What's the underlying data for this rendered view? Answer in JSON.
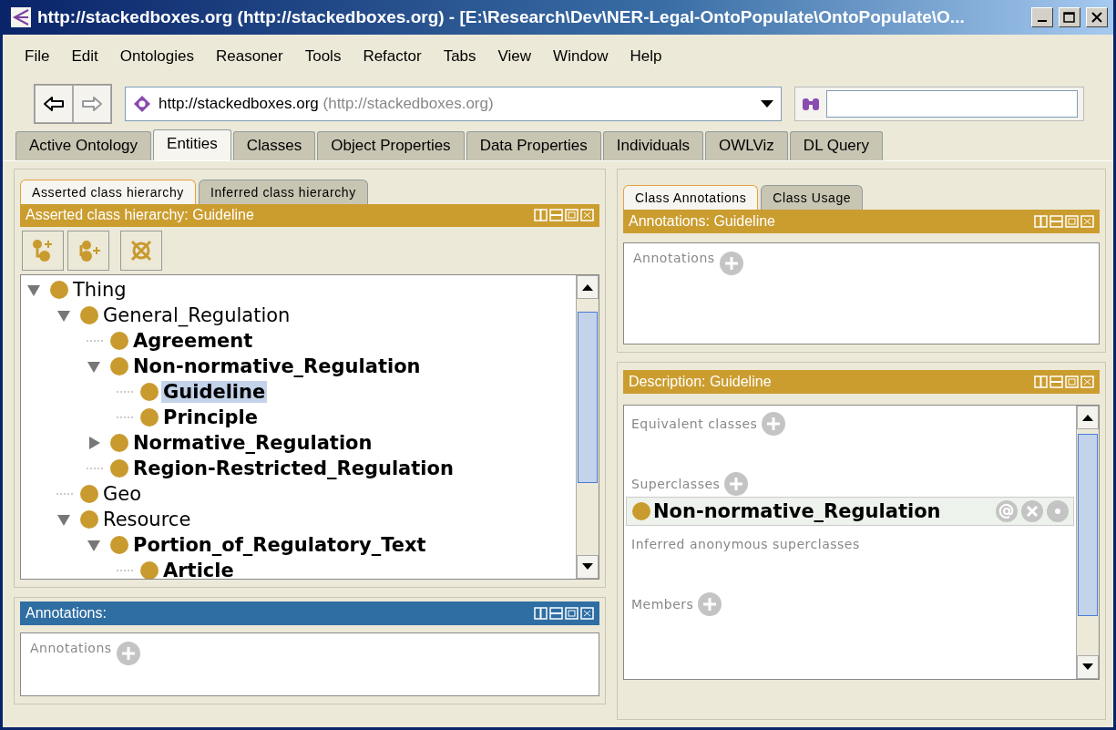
{
  "window": {
    "title": "http://stackedboxes.org (http://stackedboxes.org) - [E:\\Research\\Dev\\NER-Legal-OntoPopulate\\OntoPopulate\\O..."
  },
  "menu": [
    "File",
    "Edit",
    "Ontologies",
    "Reasoner",
    "Tools",
    "Refactor",
    "Tabs",
    "View",
    "Window",
    "Help"
  ],
  "ontology_selector": {
    "iri": "http://stackedboxes.org",
    "detail": "(http://stackedboxes.org)"
  },
  "tabs": [
    {
      "label": "Active Ontology",
      "selected": false
    },
    {
      "label": "Entities",
      "selected": true
    },
    {
      "label": "Classes",
      "selected": false
    },
    {
      "label": "Object Properties",
      "selected": false
    },
    {
      "label": "Data Properties",
      "selected": false
    },
    {
      "label": "Individuals",
      "selected": false
    },
    {
      "label": "OWLViz",
      "selected": false
    },
    {
      "label": "DL Query",
      "selected": false
    }
  ],
  "left": {
    "subtabs": [
      {
        "label": "Asserted class hierarchy",
        "selected": true
      },
      {
        "label": "Inferred class hierarchy",
        "selected": false
      }
    ],
    "hierarchy": {
      "title": "Asserted class hierarchy: Guideline",
      "focused": false,
      "tree": [
        {
          "label": "Thing",
          "bold": false,
          "expanded": true,
          "selected": false,
          "children": [
            {
              "label": "General_Regulation",
              "bold": false,
              "expanded": true,
              "selected": false,
              "children": [
                {
                  "label": "Agreement",
                  "bold": true,
                  "selected": false
                },
                {
                  "label": "Non-normative_Regulation",
                  "bold": true,
                  "expanded": true,
                  "selected": false,
                  "children": [
                    {
                      "label": "Guideline",
                      "bold": true,
                      "selected": true
                    },
                    {
                      "label": "Principle",
                      "bold": true,
                      "selected": false
                    }
                  ]
                },
                {
                  "label": "Normative_Regulation",
                  "bold": true,
                  "expanded": false,
                  "selected": false
                },
                {
                  "label": "Region-Restricted_Regulation",
                  "bold": true,
                  "selected": false
                }
              ]
            },
            {
              "label": "Geo",
              "bold": false,
              "selected": false
            },
            {
              "label": "Resource",
              "bold": false,
              "expanded": true,
              "selected": false,
              "children": [
                {
                  "label": "Portion_of_Regulatory_Text",
                  "bold": true,
                  "expanded": true,
                  "selected": false,
                  "children": [
                    {
                      "label": "Article",
                      "bold": true,
                      "selected": false
                    }
                  ]
                }
              ]
            }
          ]
        }
      ]
    },
    "annotations": {
      "title": "Annotations:",
      "focused": true,
      "section": "Annotations"
    }
  },
  "right": {
    "subtabs": [
      {
        "label": "Class Annotations",
        "selected": true
      },
      {
        "label": "Class Usage",
        "selected": false
      }
    ],
    "annotations": {
      "title": "Annotations: Guideline",
      "focused": false,
      "section": "Annotations"
    },
    "description": {
      "title": "Description: Guideline",
      "focused": false,
      "sections": [
        {
          "label": "Equivalent classes",
          "addable": true
        },
        {
          "label": "Superclasses",
          "addable": true,
          "items": [
            "Non-normative_Regulation"
          ]
        },
        {
          "label": "Inferred anonymous superclasses",
          "addable": false
        },
        {
          "label": "Members",
          "addable": true
        }
      ]
    }
  }
}
